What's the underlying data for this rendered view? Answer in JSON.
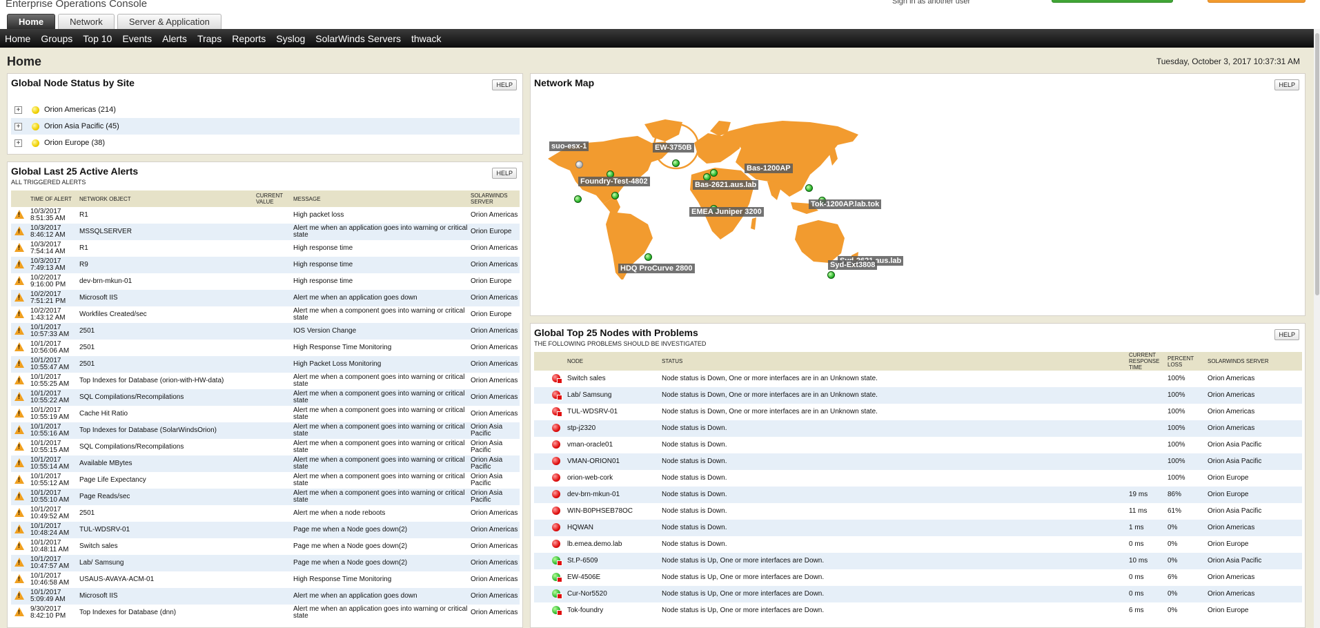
{
  "header": {
    "app_title": "Enterprise Operations Console",
    "signin_text": "Sign in as another user"
  },
  "tabs": [
    "Home",
    "Network",
    "Server & Application"
  ],
  "nav": [
    "Home",
    "Groups",
    "Top 10",
    "Events",
    "Alerts",
    "Traps",
    "Reports",
    "Syslog",
    "SolarWinds Servers",
    "thwack"
  ],
  "page": {
    "title": "Home",
    "datetime": "Tuesday, October 3, 2017 10:37:31 AM"
  },
  "help_label": "HELP",
  "site_status": {
    "title": "Global Node Status by Site",
    "sites": [
      {
        "name": "Orion Americas (214)",
        "status": "warning"
      },
      {
        "name": "Orion Asia Pacific (45)",
        "status": "warning"
      },
      {
        "name": "Orion Europe (38)",
        "status": "warning"
      }
    ]
  },
  "alerts": {
    "title": "Global Last 25 Active Alerts",
    "subtitle": "ALL TRIGGERED ALERTS",
    "columns": [
      "TIME OF ALERT",
      "NETWORK OBJECT",
      "CURRENT VALUE",
      "MESSAGE",
      "SOLARWINDS SERVER"
    ],
    "rows": [
      {
        "time": "10/3/2017 8:51:35 AM",
        "object": "R1",
        "value": "",
        "message": "High packet loss",
        "server": "Orion Americas"
      },
      {
        "time": "10/3/2017 8:46:12 AM",
        "object": "MSSQLSERVER",
        "value": "",
        "message": "Alert me when an application goes into warning or critical state",
        "server": "Orion Europe"
      },
      {
        "time": "10/3/2017 7:54:14 AM",
        "object": "R1",
        "value": "",
        "message": "High response time",
        "server": "Orion Americas"
      },
      {
        "time": "10/3/2017 7:49:13 AM",
        "object": "R9",
        "value": "",
        "message": "High response time",
        "server": "Orion Americas"
      },
      {
        "time": "10/2/2017 9:16:00 PM",
        "object": "dev-brn-mkun-01",
        "value": "",
        "message": "High response time",
        "server": "Orion Europe"
      },
      {
        "time": "10/2/2017 7:51:21 PM",
        "object": "Microsoft IIS",
        "value": "",
        "message": "Alert me when an application goes down",
        "server": "Orion Americas"
      },
      {
        "time": "10/2/2017 1:43:12 AM",
        "object": "Workfiles Created/sec",
        "value": "",
        "message": "Alert me when a component goes into warning or critical state",
        "server": "Orion Europe"
      },
      {
        "time": "10/1/2017 10:57:33 AM",
        "object": "2501",
        "value": "",
        "message": "IOS Version Change",
        "server": "Orion Americas"
      },
      {
        "time": "10/1/2017 10:56:06 AM",
        "object": "2501",
        "value": "",
        "message": "High Response Time Monitoring",
        "server": "Orion Americas"
      },
      {
        "time": "10/1/2017 10:55:47 AM",
        "object": "2501",
        "value": "",
        "message": "High Packet Loss Monitoring",
        "server": "Orion Americas"
      },
      {
        "time": "10/1/2017 10:55:25 AM",
        "object": "Top Indexes for Database (orion-with-HW-data)",
        "value": "",
        "message": "Alert me when a component goes into warning or critical state",
        "server": "Orion Americas"
      },
      {
        "time": "10/1/2017 10:55:22 AM",
        "object": "SQL Compilations/Recompilations",
        "value": "",
        "message": "Alert me when a component goes into warning or critical state",
        "server": "Orion Americas"
      },
      {
        "time": "10/1/2017 10:55:19 AM",
        "object": "Cache Hit Ratio",
        "value": "",
        "message": "Alert me when a component goes into warning or critical state",
        "server": "Orion Americas"
      },
      {
        "time": "10/1/2017 10:55:16 AM",
        "object": "Top Indexes for Database (SolarWindsOrion)",
        "value": "",
        "message": "Alert me when a component goes into warning or critical state",
        "server": "Orion Asia Pacific"
      },
      {
        "time": "10/1/2017 10:55:15 AM",
        "object": "SQL Compilations/Recompilations",
        "value": "",
        "message": "Alert me when a component goes into warning or critical state",
        "server": "Orion Asia Pacific"
      },
      {
        "time": "10/1/2017 10:55:14 AM",
        "object": "Available MBytes",
        "value": "",
        "message": "Alert me when a component goes into warning or critical state",
        "server": "Orion Asia Pacific"
      },
      {
        "time": "10/1/2017 10:55:12 AM",
        "object": "Page Life Expectancy",
        "value": "",
        "message": "Alert me when a component goes into warning or critical state",
        "server": "Orion Asia Pacific"
      },
      {
        "time": "10/1/2017 10:55:10 AM",
        "object": "Page Reads/sec",
        "value": "",
        "message": "Alert me when a component goes into warning or critical state",
        "server": "Orion Asia Pacific"
      },
      {
        "time": "10/1/2017 10:49:52 AM",
        "object": "2501",
        "value": "",
        "message": "Alert me when a node reboots",
        "server": "Orion Americas"
      },
      {
        "time": "10/1/2017 10:48:24 AM",
        "object": "TUL-WDSRV-01",
        "value": "",
        "message": "Page me when a Node goes down(2)",
        "server": "Orion Americas"
      },
      {
        "time": "10/1/2017 10:48:11 AM",
        "object": "Switch sales",
        "value": "",
        "message": "Page me when a Node goes down(2)",
        "server": "Orion Americas"
      },
      {
        "time": "10/1/2017 10:47:57 AM",
        "object": "Lab/ Samsung",
        "value": "",
        "message": "Page me when a Node goes down(2)",
        "server": "Orion Americas"
      },
      {
        "time": "10/1/2017 10:46:58 AM",
        "object": "USAUS-AVAYA-ACM-01",
        "value": "",
        "message": "High Response Time Monitoring",
        "server": "Orion Americas"
      },
      {
        "time": "10/1/2017 5:09:49 AM",
        "object": "Microsoft IIS",
        "value": "",
        "message": "Alert me when an application goes down",
        "server": "Orion Americas"
      },
      {
        "time": "9/30/2017 8:42:10 PM",
        "object": "Top Indexes for Database (dnn)",
        "value": "",
        "message": "Alert me when an application goes into warning or critical state",
        "server": "Orion Americas"
      }
    ]
  },
  "network_map": {
    "title": "Network Map",
    "map_color": "#f29b2f",
    "labels": [
      "suo-esx-1",
      "EW-3750B",
      "Bas-1200AP",
      "Foundry-Test-4802",
      "Bas-2621.aus.lab",
      "Tok-1200AP.lab.tok",
      "EMEA Juniper 3200",
      "HDQ ProCurve 2800",
      "Syd-2621.aus.lab",
      "Syd-Ext3808"
    ]
  },
  "problems": {
    "title": "Global Top 25 Nodes with Problems",
    "subtitle": "THE FOLLOWING PROBLEMS SHOULD BE INVESTIGATED",
    "columns": [
      "NODE",
      "STATUS",
      "CURRENT RESPONSE TIME",
      "PERCENT LOSS",
      "SOLARWINDS SERVER"
    ],
    "rows": [
      {
        "state": "down-flag",
        "node": "Switch sales",
        "status": "Node status is Down, One or more interfaces are in an Unknown state.",
        "response": "",
        "loss": "100%",
        "server": "Orion Americas"
      },
      {
        "state": "down-flag",
        "node": "Lab/ Samsung",
        "status": "Node status is Down, One or more interfaces are in an Unknown state.",
        "response": "",
        "loss": "100%",
        "server": "Orion Americas"
      },
      {
        "state": "down-flag",
        "node": "TUL-WDSRV-01",
        "status": "Node status is Down, One or more interfaces are in an Unknown state.",
        "response": "",
        "loss": "100%",
        "server": "Orion Americas"
      },
      {
        "state": "down",
        "node": "stp-j2320",
        "status": "Node status is Down.",
        "response": "",
        "loss": "100%",
        "server": "Orion Americas"
      },
      {
        "state": "down",
        "node": "vman-oracle01",
        "status": "Node status is Down.",
        "response": "",
        "loss": "100%",
        "server": "Orion Asia Pacific"
      },
      {
        "state": "down",
        "node": "VMAN-ORION01",
        "status": "Node status is Down.",
        "response": "",
        "loss": "100%",
        "server": "Orion Asia Pacific"
      },
      {
        "state": "down",
        "node": "orion-web-cork",
        "status": "Node status is Down.",
        "response": "",
        "loss": "100%",
        "server": "Orion Europe"
      },
      {
        "state": "down",
        "node": "dev-brn-mkun-01",
        "status": "Node status is Down.",
        "response": "19 ms",
        "loss": "86%",
        "server": "Orion Europe"
      },
      {
        "state": "down",
        "node": "WIN-B0PHSEB78OC",
        "status": "Node status is Down.",
        "response": "11 ms",
        "loss": "61%",
        "server": "Orion Asia Pacific"
      },
      {
        "state": "down",
        "node": "HQWAN",
        "status": "Node status is Down.",
        "response": "1 ms",
        "loss": "0%",
        "server": "Orion Americas"
      },
      {
        "state": "down",
        "node": "lb.emea.demo.lab",
        "status": "Node status is Down.",
        "response": "0 ms",
        "loss": "0%",
        "server": "Orion Europe"
      },
      {
        "state": "up-flag",
        "node": "St.P-6509",
        "status": "Node status is Up, One or more interfaces are Down.",
        "response": "10 ms",
        "loss": "0%",
        "server": "Orion Asia Pacific"
      },
      {
        "state": "up-flag",
        "node": "EW-4506E",
        "status": "Node status is Up, One or more interfaces are Down.",
        "response": "0 ms",
        "loss": "6%",
        "server": "Orion Americas"
      },
      {
        "state": "up-flag",
        "node": "Cur-Nor5520",
        "status": "Node status is Up, One or more interfaces are Down.",
        "response": "0 ms",
        "loss": "0%",
        "server": "Orion Americas"
      },
      {
        "state": "up-flag",
        "node": "Tok-foundry",
        "status": "Node status is Up, One or more interfaces are Down.",
        "response": "6 ms",
        "loss": "0%",
        "server": "Orion Europe"
      }
    ]
  }
}
